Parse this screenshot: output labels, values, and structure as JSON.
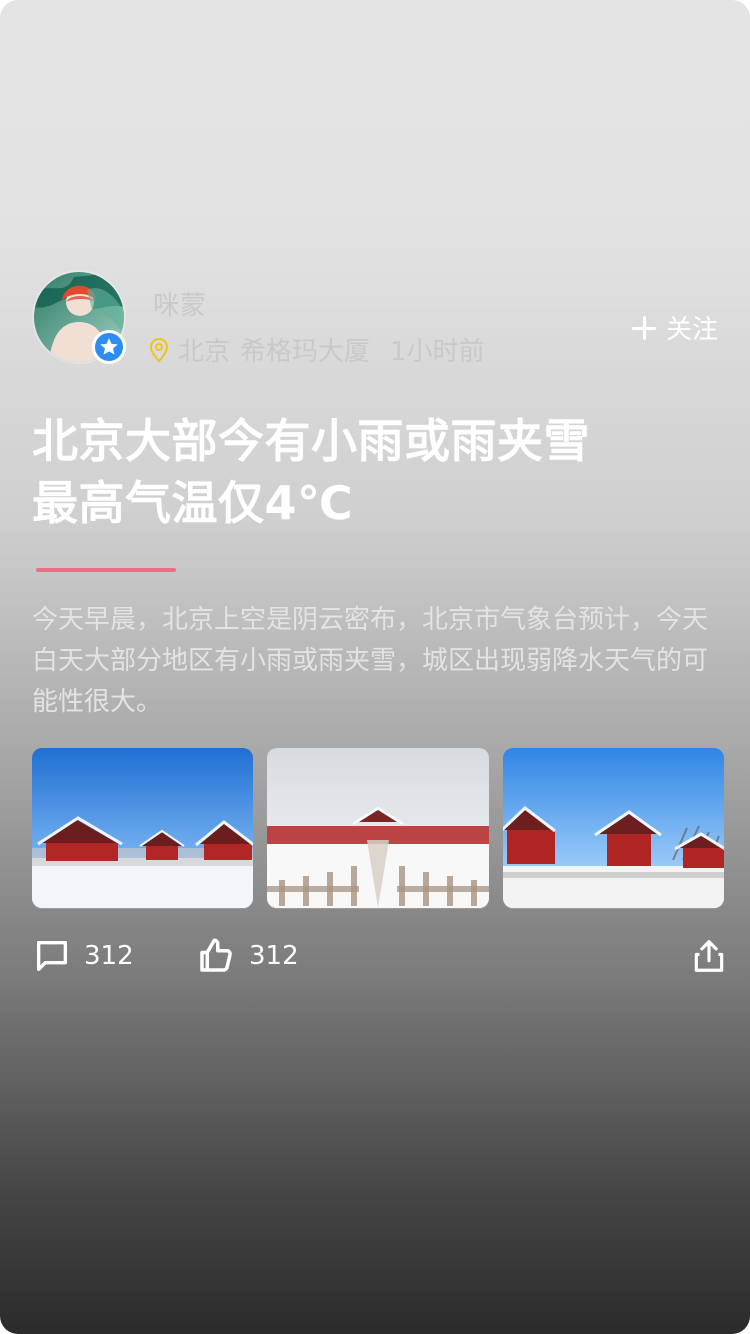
{
  "post": {
    "author": {
      "name": "咪蒙",
      "verified": true,
      "location_city": "北京",
      "location_place": "希格玛大厦",
      "time_ago": "1小时前"
    },
    "follow_label": "关注",
    "title": "北京大部今有小雨或雨夹雪\n最高气温仅4℃",
    "summary": "今天早晨，北京上空是阴云密布，北京市气象台预计，今天白天大部分地区有小雨或雨夹雪，城区出现弱降水天气的可能性很大。",
    "gallery": [
      {
        "name": "palace-hall-snow"
      },
      {
        "name": "palace-courtyard-snow"
      },
      {
        "name": "palace-pavilion-snow"
      }
    ],
    "stats": {
      "comments": "312",
      "likes": "312"
    }
  },
  "colors": {
    "accent_divider": "#f06b86",
    "verified_badge": "#2b8df3",
    "location_pin": "#f2c21b"
  },
  "icons": {
    "verified": "star-badge-icon",
    "location": "location-pin-icon",
    "follow": "plus-icon",
    "comment": "comment-bubble-icon",
    "like": "thumbs-up-icon",
    "share": "share-icon"
  }
}
